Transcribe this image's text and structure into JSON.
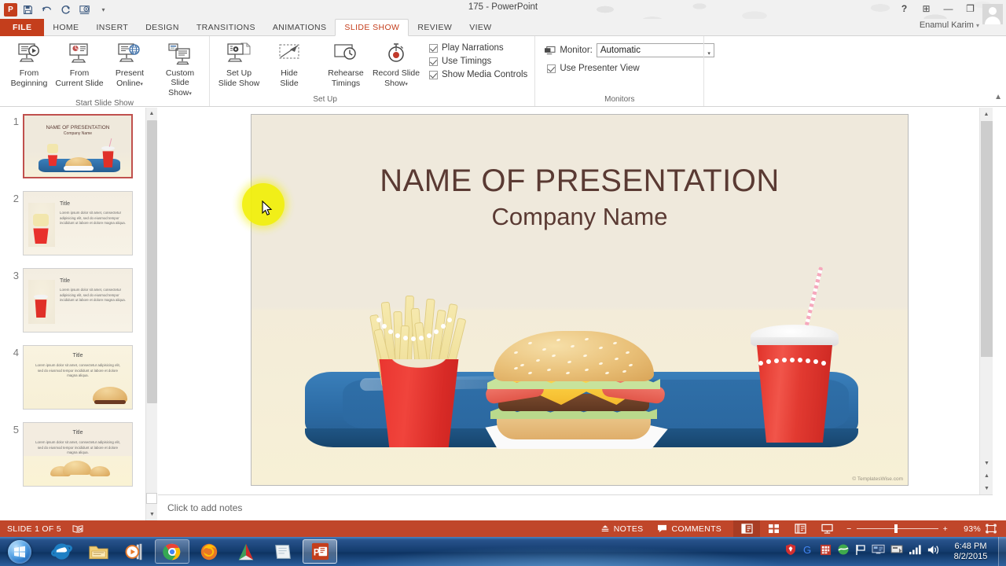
{
  "window": {
    "title": "175 - PowerPoint",
    "account_name": "Enamul Karim",
    "account_caret": "▾",
    "help_icon": "?",
    "ribbon_display_icon": "⊞",
    "minimize_icon": "—",
    "restore_icon": "❐",
    "close_icon": "✕"
  },
  "quick_access": {
    "app_icon": "powerpoint-icon",
    "save_icon": "save-icon",
    "undo_icon": "undo-icon",
    "redo_icon": "redo-icon",
    "start_from_beginning_icon": "start-slideshow-icon",
    "customize_caret": "▾"
  },
  "tabs": [
    {
      "label": "FILE",
      "active": false,
      "file": true
    },
    {
      "label": "HOME",
      "active": false
    },
    {
      "label": "INSERT",
      "active": false
    },
    {
      "label": "DESIGN",
      "active": false
    },
    {
      "label": "TRANSITIONS",
      "active": false
    },
    {
      "label": "ANIMATIONS",
      "active": false
    },
    {
      "label": "SLIDE SHOW",
      "active": true
    },
    {
      "label": "REVIEW",
      "active": false
    },
    {
      "label": "VIEW",
      "active": false
    }
  ],
  "ribbon": {
    "collapse_icon": "▲",
    "groups": [
      {
        "label": "Start Slide Show",
        "buttons": [
          {
            "line1": "From",
            "line2": "Beginning",
            "caret": ""
          },
          {
            "line1": "From",
            "line2": "Current Slide",
            "caret": ""
          },
          {
            "line1": "Present",
            "line2": "Online",
            "caret": "▾"
          },
          {
            "line1": "Custom Slide",
            "line2": "Show",
            "caret": "▾"
          }
        ]
      },
      {
        "label": "Set Up",
        "buttons": [
          {
            "line1": "Set Up",
            "line2": "Slide Show",
            "caret": ""
          },
          {
            "line1": "Hide",
            "line2": "Slide",
            "caret": ""
          },
          {
            "line1": "Rehearse",
            "line2": "Timings",
            "caret": ""
          },
          {
            "line1": "Record Slide",
            "line2": "Show",
            "caret": "▾"
          }
        ],
        "checkboxes": [
          {
            "label": "Play Narrations",
            "checked": true
          },
          {
            "label": "Use Timings",
            "checked": true
          },
          {
            "label": "Show Media Controls",
            "checked": true
          }
        ]
      },
      {
        "label": "Monitors",
        "monitor_label": "Monitor:",
        "monitor_value": "Automatic",
        "monitor_caret": "▾",
        "presenter_checkbox": {
          "label": "Use Presenter View",
          "checked": true
        }
      }
    ]
  },
  "thumbnails": {
    "scroll_up_icon": "▲",
    "scroll_down_icon": "▼",
    "slides": [
      {
        "number": "1",
        "selected": true,
        "kind": "title",
        "title": "NAME OF PRESENTATION",
        "subtitle": "Company Name"
      },
      {
        "number": "2",
        "selected": false,
        "kind": "content-left-fries",
        "title": "Title",
        "body": "Lorem ipsum dolor sit amet, consectetur adipisicing elit, sed do eiusmod tempor incididunt ut labore et dolore magna aliqua."
      },
      {
        "number": "3",
        "selected": false,
        "kind": "content-left-cup",
        "title": "Title",
        "body": "Lorem ipsum dolor sit amet, consectetur adipisicing elit, sed do eiusmod tempor incididunt ut labore et dolore magna aliqua."
      },
      {
        "number": "4",
        "selected": false,
        "kind": "content-burger",
        "title": "Title",
        "body": "Lorem ipsum dolor sit amet, consectetur adipisicing elit, sed do eiusmod tempor incididunt ut labore et dolore magna aliqua."
      },
      {
        "number": "5",
        "selected": false,
        "kind": "content-burgers",
        "title": "Title",
        "body": "Lorem ipsum dolor sit amet, consectetur adipisicing elit, sed do eiusmod tempor incididunt ut labore et dolore magna aliqua."
      }
    ]
  },
  "slide": {
    "title": "NAME OF PRESENTATION",
    "subtitle": "Company Name",
    "watermark": "© TemplatesWise.com",
    "title_color": "#5a3a33",
    "background_top": "#efe9dc",
    "background_bottom": "#f7f0d6",
    "tray_color": "#2e6ea8",
    "accent_red": "#e03028"
  },
  "notes": {
    "placeholder": "Click to add notes"
  },
  "status_bar": {
    "slide_counter": "SLIDE 1 OF 5",
    "language_icon": "proofing-icon",
    "notes_label": "NOTES",
    "notes_icon": "notes-icon",
    "comments_label": "COMMENTS",
    "comments_icon": "comments-icon",
    "views": [
      {
        "name": "normal-view",
        "active": true
      },
      {
        "name": "slide-sorter-view",
        "active": false
      },
      {
        "name": "reading-view",
        "active": false
      },
      {
        "name": "slide-show-view",
        "active": false
      }
    ],
    "zoom_out_icon": "−",
    "zoom_in_icon": "+",
    "zoom_level": "93%",
    "fit_to_window_icon": "fit-slide-icon"
  },
  "taskbar": {
    "start_icon": "windows-start-orb",
    "items": [
      {
        "name": "internet-explorer",
        "state": "pinned"
      },
      {
        "name": "windows-explorer",
        "state": "pinned"
      },
      {
        "name": "windows-media-player",
        "state": "pinned"
      },
      {
        "name": "google-chrome",
        "state": "open"
      },
      {
        "name": "mozilla-firefox",
        "state": "pinned"
      },
      {
        "name": "pdf-reader",
        "state": "pinned"
      },
      {
        "name": "notepad-app",
        "state": "pinned"
      },
      {
        "name": "powerpoint",
        "state": "active"
      }
    ],
    "tray_icons": [
      "shield-security-icon",
      "google-icon",
      "red-app-icon",
      "green-globe-icon",
      "flag-action-center-icon",
      "network-monitor-icon",
      "device-icon",
      "signal-bars-icon",
      "volume-icon"
    ],
    "clock_time": "6:48 PM",
    "clock_date": "8/2/2015"
  }
}
